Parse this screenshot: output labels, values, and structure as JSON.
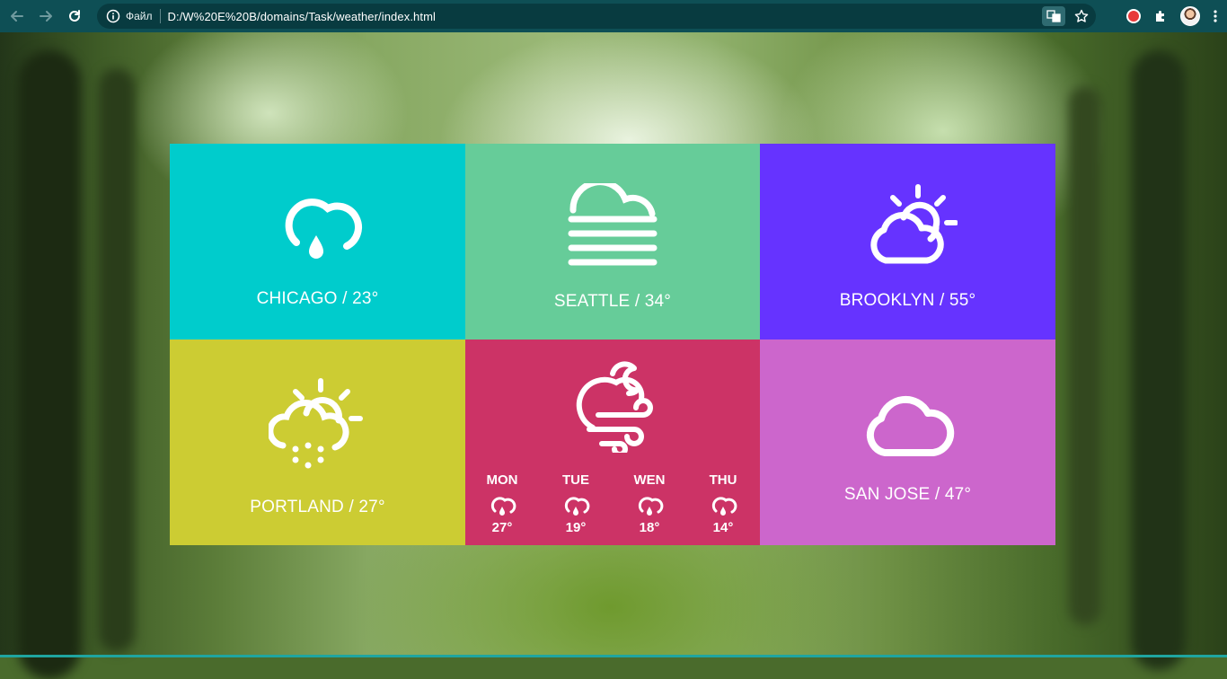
{
  "browser": {
    "scheme_label": "Файл",
    "url": "D:/W%20E%20B/domains/Task/weather/index.html"
  },
  "tiles": [
    {
      "city_temp": "CHICAGO / 23°",
      "color": "#00cccc",
      "icon": "cloud-rain-drop-icon"
    },
    {
      "city_temp": "SEATTLE / 34°",
      "color": "#66cc99",
      "icon": "fog-icon"
    },
    {
      "city_temp": "BROOKLYN / 55°",
      "color": "#6633ff",
      "icon": "sun-cloud-icon"
    },
    {
      "city_temp": "PORTLAND / 27°",
      "color": "#cccc33",
      "icon": "sun-cloud-drizzle-icon"
    },
    {
      "color": "#cc3366",
      "icon": "cloud-moon-wind-icon"
    },
    {
      "city_temp": "SAN JOSE / 47°",
      "color": "#cc66cc",
      "icon": "cloud-icon"
    }
  ],
  "forecast": [
    {
      "day": "MON",
      "temp": "27°",
      "icon": "cloud-rain-icon"
    },
    {
      "day": "TUE",
      "temp": "19°",
      "icon": "cloud-rain-icon"
    },
    {
      "day": "WEN",
      "temp": "18°",
      "icon": "cloud-rain-icon"
    },
    {
      "day": "THU",
      "temp": "14°",
      "icon": "cloud-rain-icon"
    }
  ]
}
